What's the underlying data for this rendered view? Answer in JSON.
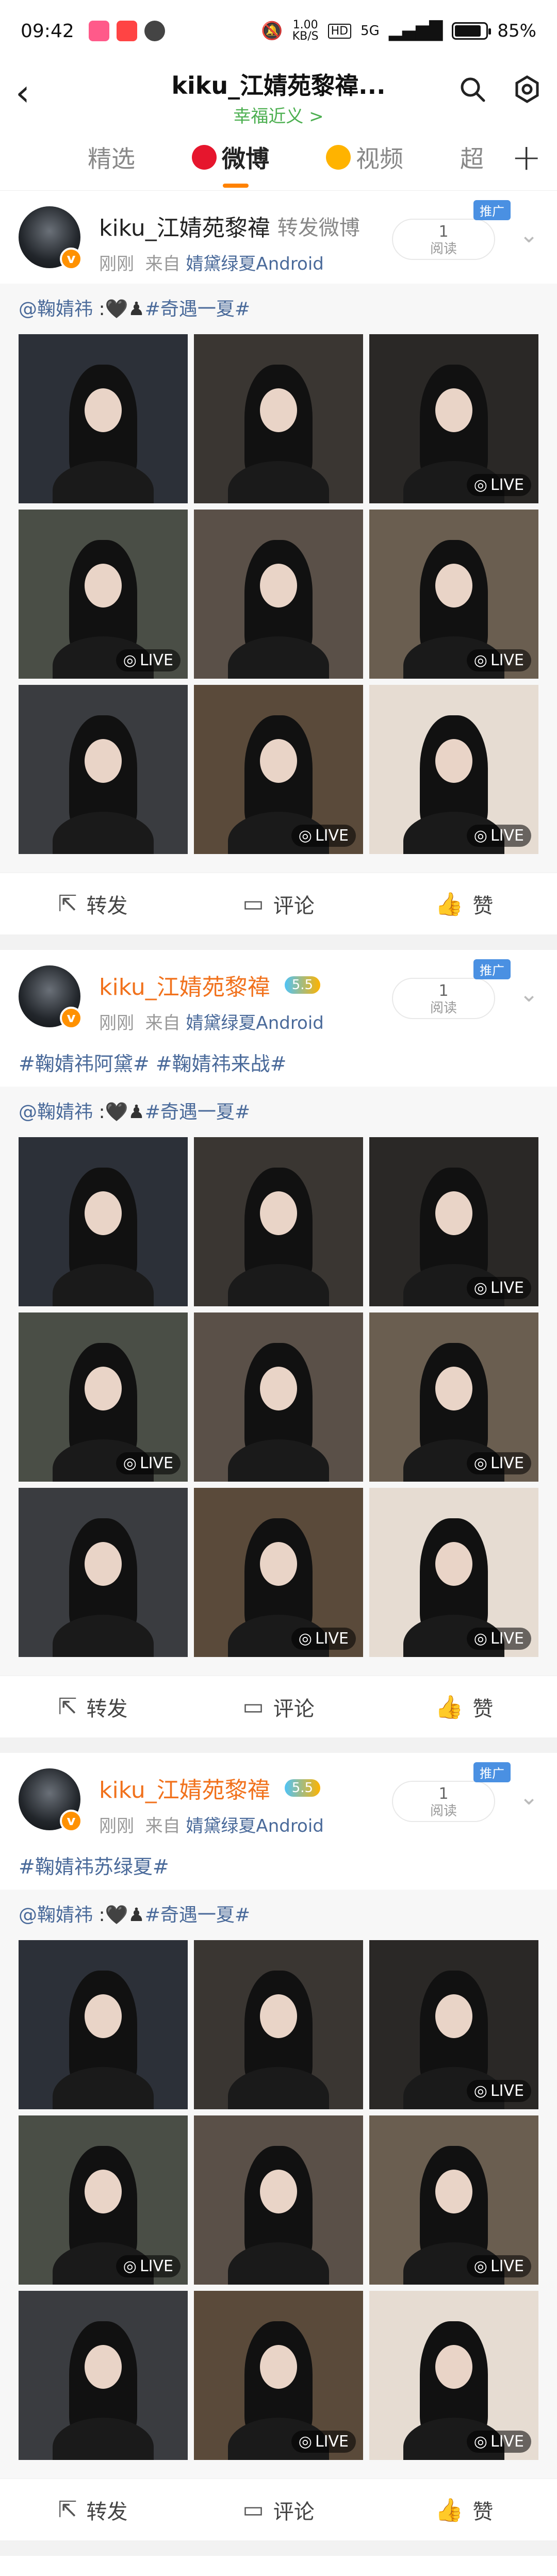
{
  "status_bar": {
    "time": "09:42",
    "net_speed_top": "1.00",
    "net_speed_bottom": "KB/S",
    "hd": "HD",
    "signal": "5G",
    "battery": "85%",
    "battery_level": 0.85
  },
  "header": {
    "title": "kiku_江婧苑黎禕...",
    "subtitle": "幸福近义 >",
    "back_icon": "back-arrow-icon",
    "search_icon": "search-icon",
    "settings_icon": "settings-icon"
  },
  "tabs": [
    {
      "label": "精选",
      "active": false
    },
    {
      "label": "微博",
      "active": true
    },
    {
      "label": "视频",
      "active": false
    },
    {
      "label": "超",
      "active": false
    }
  ],
  "posts": [
    {
      "name": "kiku_江婧苑黎禕",
      "action": "转发微博",
      "level": "",
      "time": "刚刚",
      "from": "来自",
      "source": "婧黛绿夏Android",
      "promo": "推广",
      "read_count": "1",
      "read_label": "阅读",
      "hashtags": "",
      "repost_author": "@鞠婧祎",
      "repost_sep": " :🖤♟",
      "repost_tag": "#奇遇一夏#"
    },
    {
      "name": "kiku_江婧苑黎禕",
      "action": "",
      "level": "5.5",
      "time": "刚刚",
      "from": "来自",
      "source": "婧黛绿夏Android",
      "promo": "推广",
      "read_count": "1",
      "read_label": "阅读",
      "hashtags": "#鞠婧祎阿黛# #鞠婧祎来战#",
      "repost_author": "@鞠婧祎",
      "repost_sep": " :🖤♟",
      "repost_tag": "#奇遇一夏#"
    },
    {
      "name": "kiku_江婧苑黎禕",
      "action": "",
      "level": "5.5",
      "time": "刚刚",
      "from": "来自",
      "source": "婧黛绿夏Android",
      "promo": "推广",
      "read_count": "1",
      "read_label": "阅读",
      "hashtags": "#鞠婧祎苏绿夏#",
      "repost_author": "@鞠婧祎",
      "repost_sep": " :🖤♟",
      "repost_tag": "#奇遇一夏#"
    }
  ],
  "live_label": "LIVE",
  "live_flags": [
    false,
    false,
    true,
    true,
    false,
    true,
    false,
    true,
    true
  ],
  "pic_colors": [
    "#2c3038",
    "#3a3632",
    "#2a2826",
    "#4a4e46",
    "#5a5048",
    "#6a5e50",
    "#3a3c40",
    "#5a4a3a",
    "#e6dcd2"
  ],
  "action_bar": {
    "repost": "转发",
    "comment": "评论",
    "like": "赞"
  },
  "accent": "#ff8200"
}
